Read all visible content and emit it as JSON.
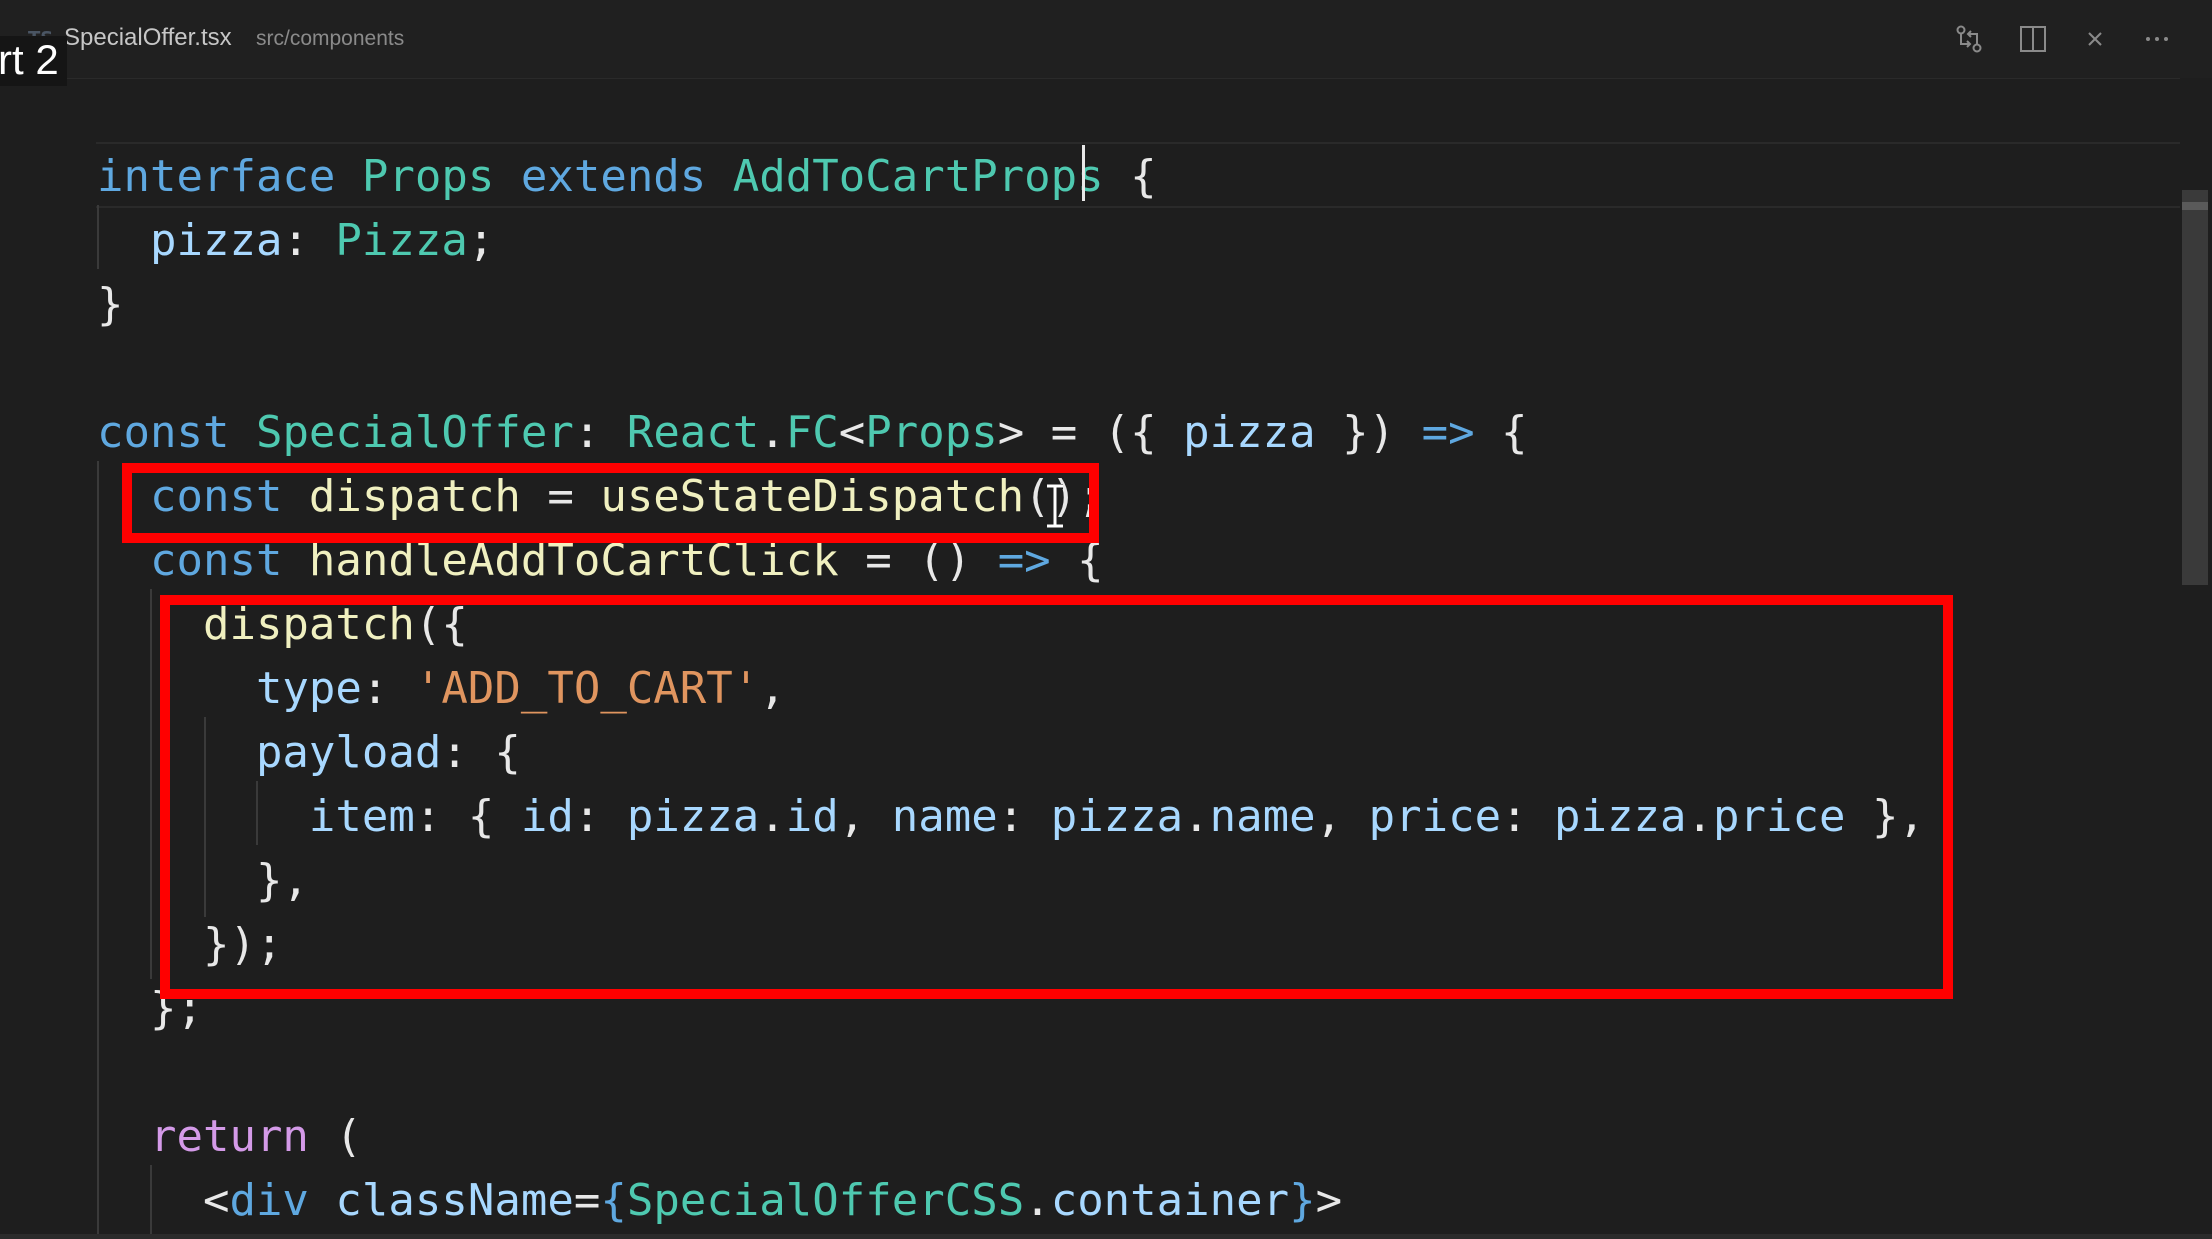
{
  "overlay": {
    "text": "rt 2"
  },
  "tab": {
    "icon": "TS",
    "filename": "SpecialOffer.tsx",
    "path": "src/components"
  },
  "tab_actions": [
    {
      "icon": "compare-changes-icon"
    },
    {
      "icon": "split-editor-icon"
    },
    {
      "icon": "close-icon"
    },
    {
      "icon": "more-actions-icon"
    }
  ],
  "code_lines": [
    {
      "tokens": [
        {
          "t": "interface ",
          "c": "kw"
        },
        {
          "t": "Props ",
          "c": "ty"
        },
        {
          "t": "extends ",
          "c": "kw"
        },
        {
          "t": "AddToCartProps",
          "c": "ty"
        },
        {
          "t": " {",
          "c": "pn"
        }
      ]
    },
    {
      "tokens": [
        {
          "t": "  pizza",
          "c": "vr"
        },
        {
          "t": ": ",
          "c": "pn"
        },
        {
          "t": "Pizza",
          "c": "ty"
        },
        {
          "t": ";",
          "c": "pn"
        }
      ]
    },
    {
      "tokens": [
        {
          "t": "}",
          "c": "pn"
        }
      ]
    },
    {
      "tokens": []
    },
    {
      "tokens": [
        {
          "t": "const ",
          "c": "kw"
        },
        {
          "t": "SpecialOffer",
          "c": "ty"
        },
        {
          "t": ": ",
          "c": "pn"
        },
        {
          "t": "React",
          "c": "ty"
        },
        {
          "t": ".",
          "c": "pn"
        },
        {
          "t": "FC",
          "c": "ty"
        },
        {
          "t": "<",
          "c": "pn"
        },
        {
          "t": "Props",
          "c": "ty"
        },
        {
          "t": "> = ({ ",
          "c": "pn"
        },
        {
          "t": "pizza",
          "c": "vr"
        },
        {
          "t": " }) ",
          "c": "pn"
        },
        {
          "t": "=>",
          "c": "ar"
        },
        {
          "t": " {",
          "c": "pn"
        }
      ]
    },
    {
      "tokens": [
        {
          "t": "  const ",
          "c": "kw"
        },
        {
          "t": "dispatch",
          "c": "fn"
        },
        {
          "t": " = ",
          "c": "pn"
        },
        {
          "t": "useStateDispatch",
          "c": "fn"
        },
        {
          "t": "();",
          "c": "pn"
        }
      ]
    },
    {
      "tokens": [
        {
          "t": "  const ",
          "c": "kw"
        },
        {
          "t": "handleAddToCartClick",
          "c": "fn"
        },
        {
          "t": " = () ",
          "c": "pn"
        },
        {
          "t": "=>",
          "c": "ar"
        },
        {
          "t": " {",
          "c": "pn"
        }
      ]
    },
    {
      "tokens": [
        {
          "t": "    dispatch",
          "c": "fn"
        },
        {
          "t": "({",
          "c": "pn"
        }
      ]
    },
    {
      "tokens": [
        {
          "t": "      type",
          "c": "vr"
        },
        {
          "t": ": ",
          "c": "pn"
        },
        {
          "t": "'ADD_TO_CART'",
          "c": "str"
        },
        {
          "t": ",",
          "c": "pn"
        }
      ]
    },
    {
      "tokens": [
        {
          "t": "      payload",
          "c": "vr"
        },
        {
          "t": ": {",
          "c": "pn"
        }
      ]
    },
    {
      "tokens": [
        {
          "t": "        item",
          "c": "vr"
        },
        {
          "t": ": { ",
          "c": "pn"
        },
        {
          "t": "id",
          "c": "vr"
        },
        {
          "t": ": ",
          "c": "pn"
        },
        {
          "t": "pizza",
          "c": "vr"
        },
        {
          "t": ".",
          "c": "pn"
        },
        {
          "t": "id",
          "c": "vr"
        },
        {
          "t": ", ",
          "c": "pn"
        },
        {
          "t": "name",
          "c": "vr"
        },
        {
          "t": ": ",
          "c": "pn"
        },
        {
          "t": "pizza",
          "c": "vr"
        },
        {
          "t": ".",
          "c": "pn"
        },
        {
          "t": "name",
          "c": "vr"
        },
        {
          "t": ", ",
          "c": "pn"
        },
        {
          "t": "price",
          "c": "vr"
        },
        {
          "t": ": ",
          "c": "pn"
        },
        {
          "t": "pizza",
          "c": "vr"
        },
        {
          "t": ".",
          "c": "pn"
        },
        {
          "t": "price",
          "c": "vr"
        },
        {
          "t": " },",
          "c": "pn"
        }
      ]
    },
    {
      "tokens": [
        {
          "t": "      },",
          "c": "pn"
        }
      ]
    },
    {
      "tokens": [
        {
          "t": "    });",
          "c": "pn"
        }
      ]
    },
    {
      "tokens": [
        {
          "t": "  };",
          "c": "pn"
        }
      ]
    },
    {
      "tokens": []
    },
    {
      "tokens": [
        {
          "t": "  return",
          "c": "pk"
        },
        {
          "t": " (",
          "c": "pn"
        }
      ]
    },
    {
      "tokens": [
        {
          "t": "    <",
          "c": "pn"
        },
        {
          "t": "div ",
          "c": "kw"
        },
        {
          "t": "className",
          "c": "vr"
        },
        {
          "t": "=",
          "c": "pn"
        },
        {
          "t": "{",
          "c": "kw"
        },
        {
          "t": "SpecialOfferCSS",
          "c": "ty"
        },
        {
          "t": ".",
          "c": "pn"
        },
        {
          "t": "container",
          "c": "vr"
        },
        {
          "t": "}",
          "c": "kw"
        },
        {
          "t": ">",
          "c": "pn"
        }
      ]
    }
  ],
  "colors": {
    "highlight": "#ff0000",
    "keyword": "#5fa8e0",
    "type": "#4ec9b0",
    "variable": "#a8d8ff",
    "function": "#f0f0c0",
    "string": "#e0955f",
    "control": "#d49ae8"
  }
}
